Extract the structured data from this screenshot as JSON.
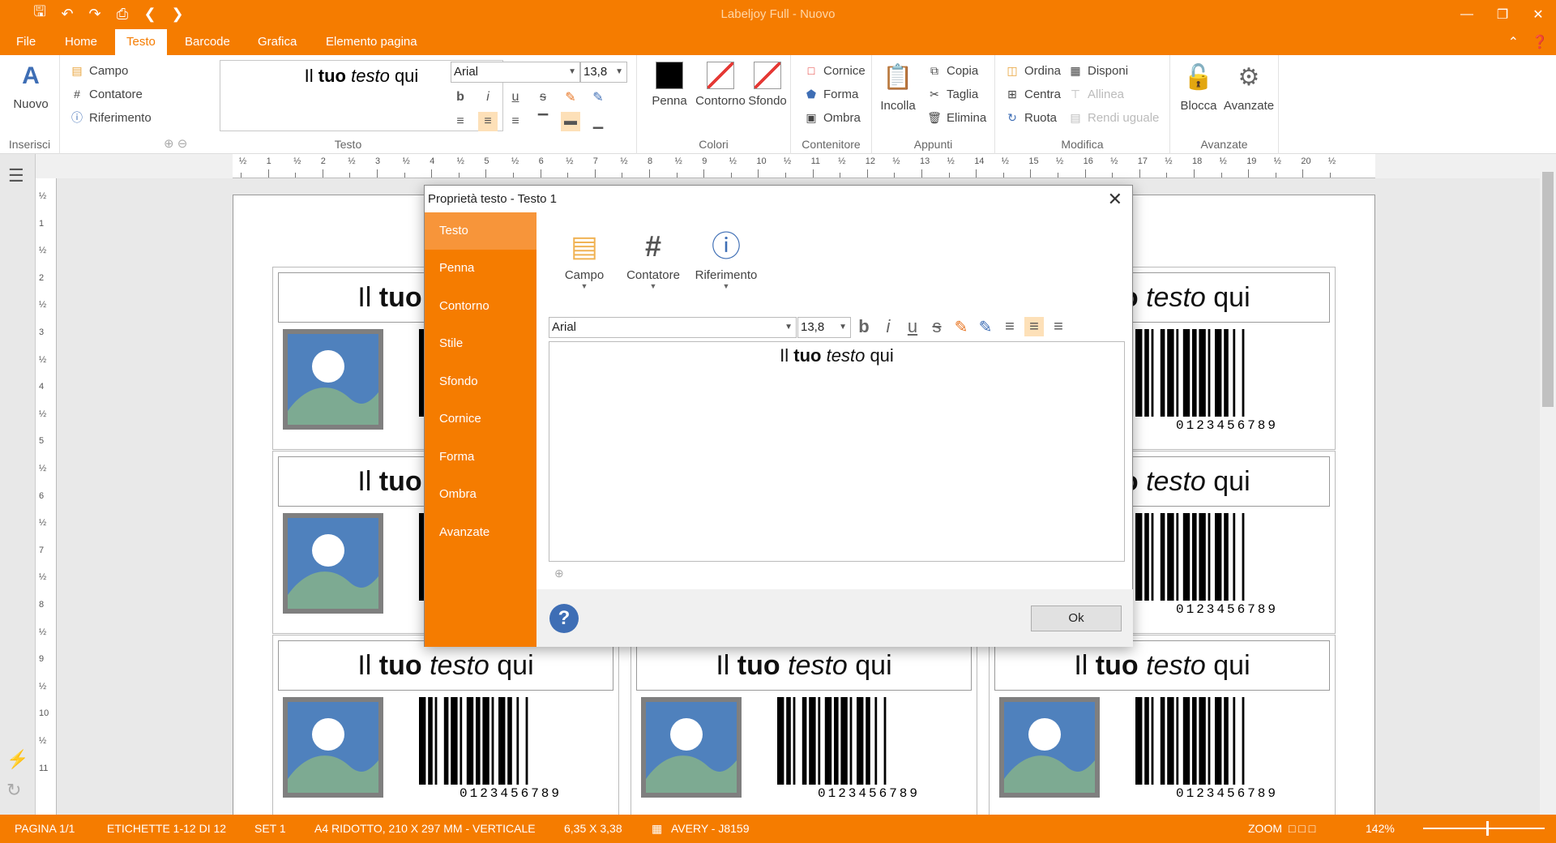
{
  "window": {
    "title": "Labeljoy Full - Nuovo",
    "quick_access": [
      "save-icon",
      "undo-icon",
      "redo-icon",
      "print-icon",
      "back-icon",
      "forward-icon"
    ],
    "controls": [
      "minimize-icon",
      "restore-icon",
      "close-icon"
    ]
  },
  "menu": {
    "tabs": [
      "File",
      "Home",
      "Testo",
      "Barcode",
      "Grafica",
      "Elemento pagina"
    ],
    "active": "Testo"
  },
  "ribbon": {
    "nuovo": "Nuovo",
    "inserisci_label": "Inserisci",
    "campo": "Campo",
    "contatore": "Contatore",
    "riferimento": "Riferimento",
    "preview_plain": "Il ",
    "preview_bold": "tuo",
    "preview_italic": "testo",
    "preview_tail": " qui",
    "testo_label": "Testo",
    "font": "Arial",
    "size": "13,8",
    "penna": "Penna",
    "contorno": "Contorno",
    "sfondo": "Sfondo",
    "colori_label": "Colori",
    "cornice": "Cornice",
    "forma": "Forma",
    "ombra": "Ombra",
    "contenitore_label": "Contenitore",
    "incolla": "Incolla",
    "copia": "Copia",
    "taglia": "Taglia",
    "elimina": "Elimina",
    "appunti_label": "Appunti",
    "ordina": "Ordina",
    "disponi": "Disponi",
    "centra": "Centra",
    "allinea": "Allinea",
    "ruota": "Ruota",
    "rendi_uguale": "Rendi uguale",
    "modifica_label": "Modifica",
    "blocca": "Blocca",
    "avanzate": "Avanzate",
    "avanzate_label": "Avanzate"
  },
  "ruler": {
    "h": [
      "½",
      "1",
      "½",
      "2",
      "½",
      "3",
      "½",
      "4",
      "½",
      "5",
      "½",
      "6",
      "½",
      "7",
      "½",
      "8",
      "½",
      "9",
      "½",
      "10",
      "½",
      "11",
      "½",
      "12",
      "½",
      "13",
      "½",
      "14",
      "½",
      "15",
      "½",
      "16",
      "½",
      "17",
      "½",
      "18",
      "½",
      "19",
      "½",
      "20",
      "½"
    ],
    "v": [
      "½",
      "1",
      "½",
      "2",
      "½",
      "3",
      "½",
      "4",
      "½",
      "5",
      "½",
      "6",
      "½",
      "7",
      "½",
      "8",
      "½",
      "9",
      "½",
      "10",
      "½",
      "11"
    ]
  },
  "labels": {
    "plain": "Il ",
    "bold": "tuo",
    "italic": "testo",
    "tail": " qui",
    "barcode_number": "0123456789"
  },
  "dialog": {
    "title": "Proprietà testo - Testo 1",
    "side_items": [
      "Testo",
      "Penna",
      "Contorno",
      "Stile",
      "Sfondo",
      "Cornice",
      "Forma",
      "Ombra",
      "Avanzate"
    ],
    "selected": "Testo",
    "campo": "Campo",
    "contatore": "Contatore",
    "riferimento": "Riferimento",
    "font": "Arial",
    "size": "13,8",
    "editor_plain": "Il ",
    "editor_bold": "tuo",
    "editor_italic": "testo",
    "editor_tail": " qui",
    "ok": "Ok"
  },
  "status": {
    "pagina": "PAGINA 1/1",
    "etichette": "ETICHETTE 1-12 DI 12",
    "set": "SET 1",
    "formato": "A4 RIDOTTO, 210 X 297 MM - VERTICALE",
    "dimensione": "6,35 X 3,38",
    "avery": "AVERY - J8159",
    "zoom_label": "ZOOM",
    "zoom": "142%"
  },
  "colors": {
    "accent": "#f57c00",
    "accent_light": "#f7953a"
  }
}
